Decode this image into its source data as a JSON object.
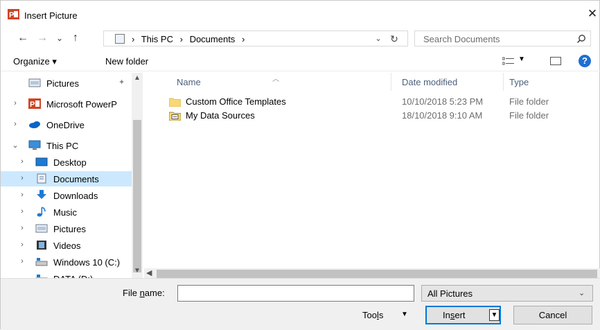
{
  "window": {
    "title": "Insert Picture",
    "close_glyph": "✕"
  },
  "nav": {
    "back_glyph": "←",
    "forward_glyph": "→",
    "recent_glyph": "⌄",
    "up_glyph": "↑",
    "breadcrumbs": [
      "This PC",
      "Documents"
    ],
    "separator": "›",
    "search_placeholder": "Search Documents"
  },
  "toolbar": {
    "organize": "Organize ▾",
    "new_folder": "New folder",
    "help": "?"
  },
  "tree": [
    {
      "label": "Pictures",
      "icon": "pictures-folder-icon",
      "expander": "",
      "pinned": true
    },
    {
      "label": "Microsoft PowerP",
      "icon": "powerpoint-icon",
      "expander": "›"
    },
    {
      "label": "OneDrive",
      "icon": "onedrive-icon",
      "expander": "›"
    },
    {
      "label": "This PC",
      "icon": "computer-icon",
      "expander": "⌄"
    },
    {
      "label": "Desktop",
      "icon": "desktop-icon",
      "expander": "›"
    },
    {
      "label": "Documents",
      "icon": "documents-icon",
      "expander": "›",
      "selected": true
    },
    {
      "label": "Downloads",
      "icon": "downloads-icon",
      "expander": "›"
    },
    {
      "label": "Music",
      "icon": "music-icon",
      "expander": "›"
    },
    {
      "label": "Pictures",
      "icon": "pictures-folder-icon",
      "expander": "›"
    },
    {
      "label": "Videos",
      "icon": "videos-icon",
      "expander": "›"
    },
    {
      "label": "Windows 10 (C:)",
      "icon": "drive-icon",
      "expander": "›"
    },
    {
      "label": "DATA (D:)",
      "icon": "drive-icon",
      "expander": ""
    }
  ],
  "files": {
    "columns": [
      "Name",
      "Date modified",
      "Type"
    ],
    "rows": [
      {
        "name": "Custom Office Templates",
        "date": "10/10/2018 5:23 PM",
        "type": "File folder",
        "icon": "folder-icon"
      },
      {
        "name": "My Data Sources",
        "date": "18/10/2018 9:10 AM",
        "type": "File folder",
        "icon": "data-sources-folder-icon"
      }
    ]
  },
  "footer": {
    "file_name_prefix": "File ",
    "file_name_accel": "n",
    "file_name_suffix": "ame:",
    "file_name_value": "",
    "filter_value": "All Pictures",
    "tools_prefix": "Too",
    "tools_accel": "l",
    "tools_suffix": "s",
    "insert_prefix": "In",
    "insert_accel": "s",
    "insert_suffix": "ert",
    "cancel": "Cancel"
  },
  "colors": {
    "accent": "#0078d7",
    "selection": "#cce8ff",
    "folder": "#f8d775",
    "powerpoint": "#d04423"
  }
}
